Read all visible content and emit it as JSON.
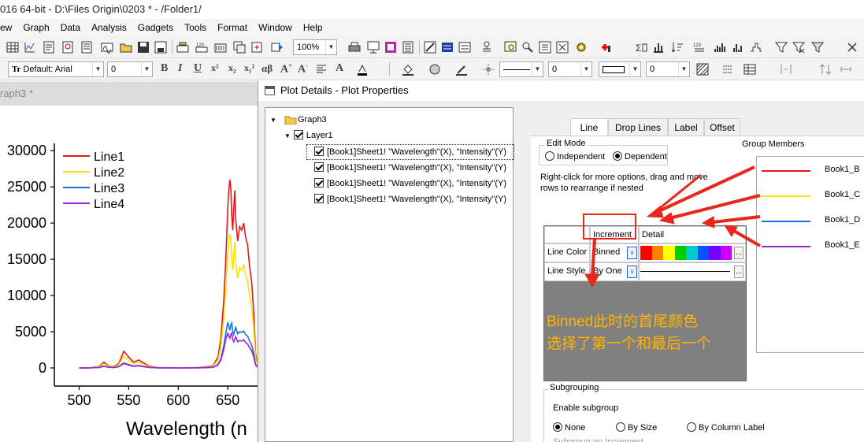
{
  "window": {
    "title": "016 64-bit - D:\\Files Origin\\0203 * - /Folder1/"
  },
  "menu": {
    "items": [
      "ew",
      "Graph",
      "Data",
      "Analysis",
      "Gadgets",
      "Tools",
      "Format",
      "Window",
      "Help"
    ]
  },
  "toolbar": {
    "zoom_value": "100%",
    "font_value": "Default: Arial",
    "font_size_value": "0",
    "line_width_value": "0",
    "line_width2_value": "0"
  },
  "graph_window": {
    "title": "raph3 *",
    "chart_data": {
      "type": "line",
      "xlabel": "Wavelength (n",
      "ylabel": "",
      "xlim": [
        475,
        680
      ],
      "ylim": [
        -2500,
        31000
      ],
      "x_ticks": [
        "500",
        "550",
        "600",
        "650"
      ],
      "y_ticks": [
        "0",
        "5000",
        "10000",
        "15000",
        "20000",
        "25000",
        "30000"
      ],
      "legend_placement": "top-left",
      "x": [
        500,
        510,
        515,
        520,
        525,
        530,
        535,
        540,
        545,
        550,
        555,
        560,
        565,
        570,
        580,
        600,
        620,
        635,
        640,
        643,
        646,
        648,
        650,
        651,
        652,
        653,
        654,
        655,
        656,
        657,
        658,
        660,
        662,
        664,
        666,
        668,
        670,
        672,
        674,
        676,
        678,
        680
      ],
      "series": [
        {
          "name": "Line1",
          "color": "#e8161a",
          "values": [
            0,
            0,
            100,
            200,
            800,
            300,
            200,
            600,
            2300,
            1500,
            800,
            1100,
            700,
            300,
            50,
            0,
            50,
            300,
            1500,
            4000,
            9500,
            15000,
            22000,
            24500,
            26000,
            25000,
            21000,
            19000,
            22000,
            24500,
            20500,
            17500,
            19500,
            19000,
            20000,
            18000,
            17000,
            14000,
            12000,
            8000,
            2000,
            500
          ]
        },
        {
          "name": "Line2",
          "color": "#f5e400",
          "values": [
            0,
            0,
            80,
            150,
            600,
            250,
            150,
            450,
            1600,
            1100,
            600,
            800,
            500,
            200,
            40,
            0,
            40,
            220,
            1100,
            2900,
            7000,
            11000,
            15600,
            17500,
            18500,
            17800,
            15000,
            13500,
            15500,
            17300,
            14500,
            12400,
            13800,
            13500,
            14200,
            12800,
            12000,
            10000,
            8500,
            5700,
            1400,
            400
          ]
        },
        {
          "name": "Line3",
          "color": "#1a73e0",
          "values": [
            0,
            0,
            40,
            70,
            260,
            110,
            70,
            200,
            700,
            480,
            260,
            350,
            220,
            90,
            20,
            0,
            20,
            100,
            480,
            1300,
            3100,
            4800,
            6300,
            5800,
            5200,
            5900,
            6200,
            5000,
            4600,
            5200,
            5600,
            4700,
            5000,
            4900,
            5100,
            4600,
            4400,
            3700,
            3200,
            2100,
            500,
            150
          ]
        },
        {
          "name": "Line4",
          "color": "#9a22d8",
          "values": [
            0,
            0,
            30,
            60,
            220,
            90,
            60,
            170,
            600,
            400,
            220,
            300,
            180,
            80,
            15,
            0,
            15,
            80,
            400,
            1100,
            2600,
            4000,
            4800,
            4400,
            4100,
            4600,
            4800,
            3900,
            3600,
            4000,
            4300,
            3600,
            3800,
            3700,
            3900,
            3500,
            3300,
            2800,
            2400,
            1600,
            400,
            100
          ]
        }
      ]
    }
  },
  "dialog": {
    "title": "Plot Details - Plot Properties",
    "tree": {
      "root": "Graph3",
      "layer": "Layer1",
      "plots": [
        "[Book1]Sheet1! \"Wavelength\"(X), \"Intensity\"(Y)",
        "[Book1]Sheet1! \"Wavelength\"(X), \"Intensity\"(Y)",
        "[Book1]Sheet1! \"Wavelength\"(X), \"Intensity\"(Y)",
        "[Book1]Sheet1! \"Wavelength\"(X), \"Intensity\"(Y)"
      ]
    },
    "tabs": [
      "Line",
      "Drop Lines",
      "Label",
      "Offset"
    ],
    "edit_mode": {
      "label": "Edit Mode",
      "independent": "Independent",
      "dependent": "Dependent",
      "selected": "Dependent"
    },
    "hint": "Right-click for more options, drag and move rows to  rearrange if nested",
    "grid": {
      "headers": [
        "Increment",
        "Detail"
      ],
      "rows": [
        {
          "label": "Line Color",
          "increment": "Binned"
        },
        {
          "label": "Line Style",
          "increment": "By One"
        }
      ],
      "more_button": "..."
    },
    "palette_colors": [
      "#ff0000",
      "#ff7f00",
      "#ffff00",
      "#00cc00",
      "#00cccc",
      "#0055ff",
      "#7700ff",
      "#cc00ff"
    ],
    "group_members": {
      "title": "Group Members",
      "items": [
        {
          "name": "Book1_B",
          "color": "#e8161a"
        },
        {
          "name": "Book1_C",
          "color": "#f5e400"
        },
        {
          "name": "Book1_D",
          "color": "#1a73e0"
        },
        {
          "name": "Book1_E",
          "color": "#9a22d8"
        }
      ]
    },
    "annotation": {
      "line1": "Binned此时的首尾颜色",
      "line2": "选择了第一个和最后一个",
      "color": "#ffb300"
    },
    "subgrouping": {
      "title": "Subgrouping",
      "enable": "Enable subgroup",
      "options": [
        "None",
        "By Size",
        "By Column Label"
      ],
      "selected": "None",
      "increment_label": "Subgroup on Increment"
    }
  }
}
